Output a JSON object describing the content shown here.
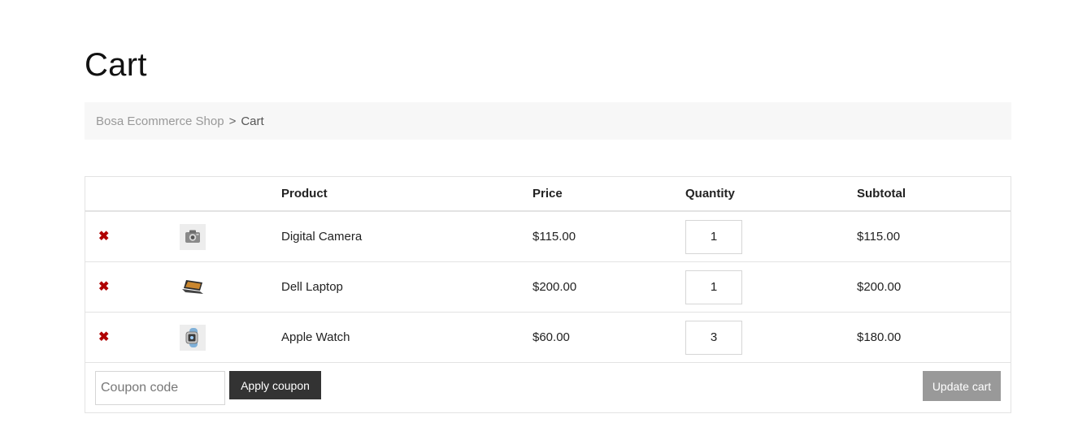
{
  "page": {
    "title": "Cart"
  },
  "breadcrumb": {
    "home": "Bosa Ecommerce Shop",
    "separator": ">",
    "current": "Cart"
  },
  "cart": {
    "headers": {
      "product": "Product",
      "price": "Price",
      "quantity": "Quantity",
      "subtotal": "Subtotal"
    },
    "remove_glyph": "✖",
    "items": [
      {
        "product": "Digital Camera",
        "price": "$115.00",
        "quantity": "1",
        "subtotal": "$115.00",
        "thumb_icon": "camera-icon"
      },
      {
        "product": "Dell Laptop",
        "price": "$200.00",
        "quantity": "1",
        "subtotal": "$200.00",
        "thumb_icon": "laptop-icon"
      },
      {
        "product": "Apple Watch",
        "price": "$60.00",
        "quantity": "3",
        "subtotal": "$180.00",
        "thumb_icon": "watch-icon"
      }
    ]
  },
  "actions": {
    "coupon_placeholder": "Coupon code",
    "apply_coupon_label": "Apply coupon",
    "update_cart_label": "Update cart"
  },
  "colors": {
    "remove": "#b00000",
    "apply_button": "#333333",
    "update_button": "#999999",
    "breadcrumb_bg": "#f7f7f7"
  }
}
